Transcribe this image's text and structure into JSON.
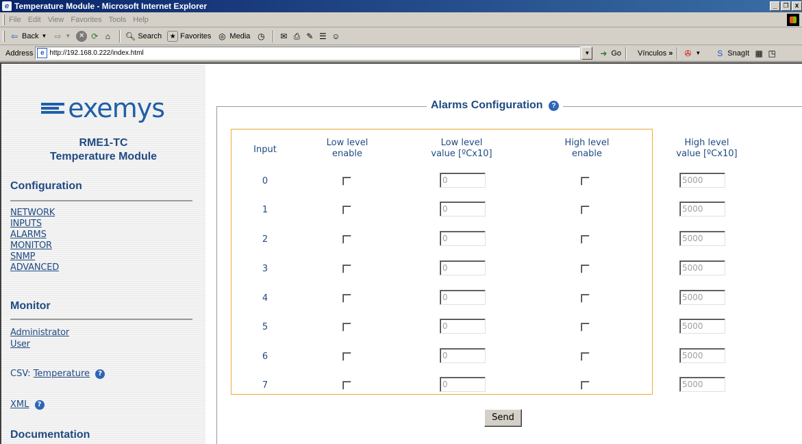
{
  "window": {
    "title": "Temperature Module - Microsoft Internet Explorer",
    "controls": [
      "_",
      "8",
      "x"
    ]
  },
  "menu": [
    "File",
    "Edit",
    "View",
    "Favorites",
    "Tools",
    "Help"
  ],
  "toolbar": {
    "back": "Back",
    "search": "Search",
    "favorites": "Favorites",
    "media": "Media"
  },
  "address": {
    "label": "Address",
    "url": "http://192.168.0.222/index.html",
    "go": "Go",
    "links": "Vínculos",
    "snagit": "SnagIt"
  },
  "sidebar": {
    "brand": "exemys",
    "model": "RME1-TC",
    "subtitle": "Temperature Module",
    "configuration_title": "Configuration",
    "config_links": [
      "NETWORK",
      "INPUTS",
      "ALARMS",
      "MONITOR",
      "SNMP",
      "ADVANCED"
    ],
    "monitor_title": "Monitor",
    "monitor_links": [
      "Administrator",
      "User"
    ],
    "csv_label": "CSV:",
    "csv_link": "Temperature",
    "xml_link": "XML",
    "documentation_title": "Documentation"
  },
  "main": {
    "legend": "Alarms Configuration",
    "headers": {
      "input": "Input",
      "low_enable_1": "Low level",
      "low_enable_2": "enable",
      "low_value_1": "Low level",
      "low_value_2": "value [ºCx10]",
      "high_enable_1": "High level",
      "high_enable_2": "enable",
      "high_value_1": "High level",
      "high_value_2": "value [ºCx10]"
    },
    "rows": [
      {
        "input": "0",
        "low_value": "0",
        "high_value": "5000"
      },
      {
        "input": "1",
        "low_value": "0",
        "high_value": "5000"
      },
      {
        "input": "2",
        "low_value": "0",
        "high_value": "5000"
      },
      {
        "input": "3",
        "low_value": "0",
        "high_value": "5000"
      },
      {
        "input": "4",
        "low_value": "0",
        "high_value": "5000"
      },
      {
        "input": "5",
        "low_value": "0",
        "high_value": "5000"
      },
      {
        "input": "6",
        "low_value": "0",
        "high_value": "5000"
      },
      {
        "input": "7",
        "low_value": "0",
        "high_value": "5000"
      }
    ],
    "send_label": "Send"
  }
}
